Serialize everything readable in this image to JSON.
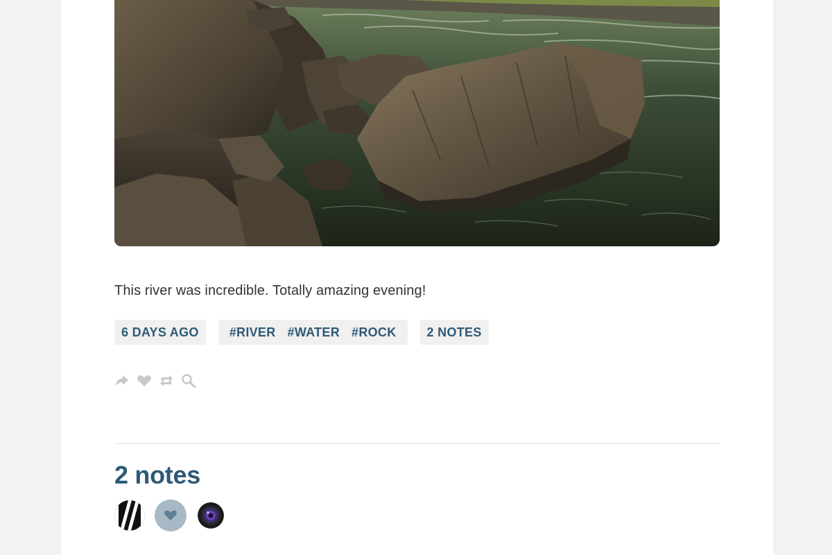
{
  "post": {
    "caption": "This river was incredible. Totally amazing evening!",
    "date_label": "6 DAYS AGO",
    "tags": [
      "#RIVER",
      "#WATER",
      "#ROCK"
    ],
    "notes_label": "2 NOTES"
  },
  "actions": {
    "icons": [
      "share-icon",
      "heart-icon",
      "reblog-icon",
      "search-icon"
    ]
  },
  "notes": {
    "title": "2 notes",
    "avatars": [
      "user-avatar-1",
      "like-heart-avatar",
      "camera-lens-avatar"
    ]
  },
  "colors": {
    "accent": "#2e5a77",
    "pill_bg": "#f0f0f0",
    "icon_gray": "#c8c8c8",
    "like_bg": "#a7b9c4"
  }
}
